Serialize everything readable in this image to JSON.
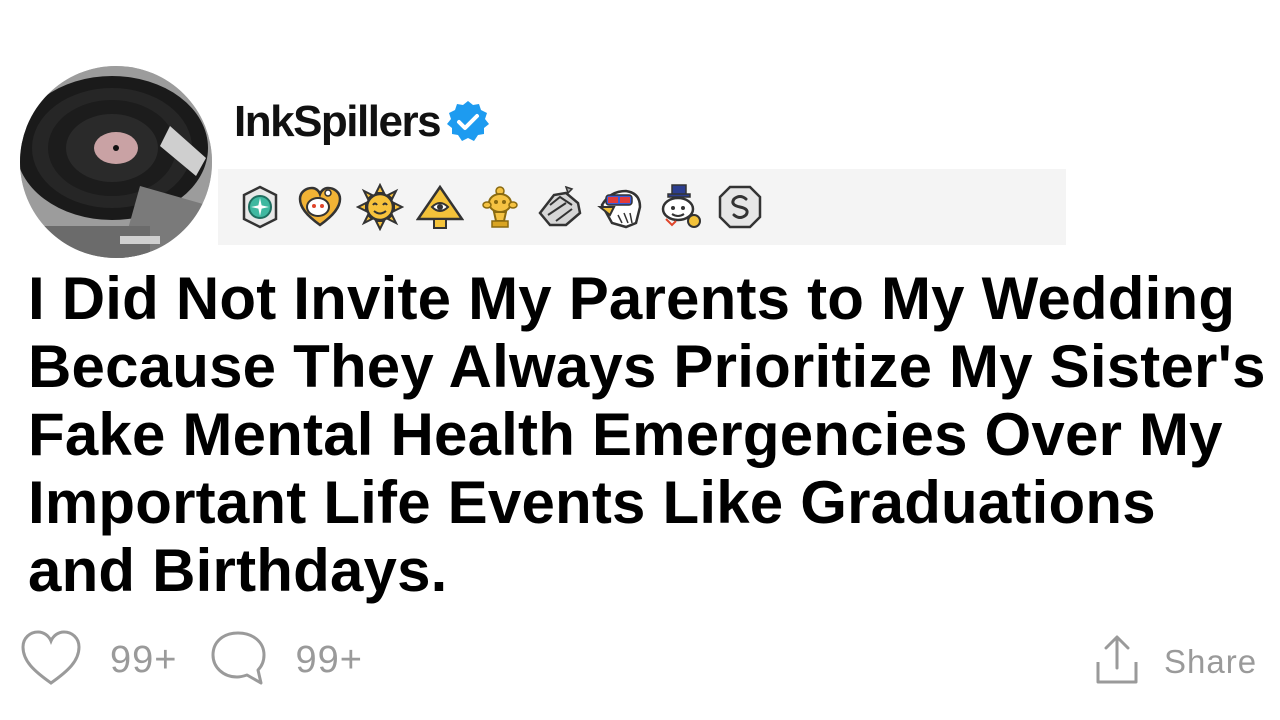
{
  "post": {
    "username": "InkSpillers",
    "verified": true,
    "title": "I Did Not Invite My Parents to My Wedding Because They Always Prioritize My Sister's Fake Mental Health Emergencies Over My Important Life Events Like Graduations and Birthdays."
  },
  "awards": [
    {
      "icon": "compass-badge-award-icon"
    },
    {
      "icon": "wholesome-heart-award-icon"
    },
    {
      "icon": "smiling-sun-award-icon"
    },
    {
      "icon": "pyramid-eye-award-icon"
    },
    {
      "icon": "gold-trophy-award-icon"
    },
    {
      "icon": "handshake-award-icon"
    },
    {
      "icon": "patriotic-eagle-award-icon"
    },
    {
      "icon": "snoo-top-hat-award-icon"
    },
    {
      "icon": "silver-badge-award-icon"
    }
  ],
  "actions": {
    "like_count": "99+",
    "comment_count": "99+",
    "share_label": "Share"
  },
  "colors": {
    "verified_blue": "#1d9bf0",
    "action_gray": "#9a9a9a",
    "award_bar_bg": "#f4f4f4"
  }
}
